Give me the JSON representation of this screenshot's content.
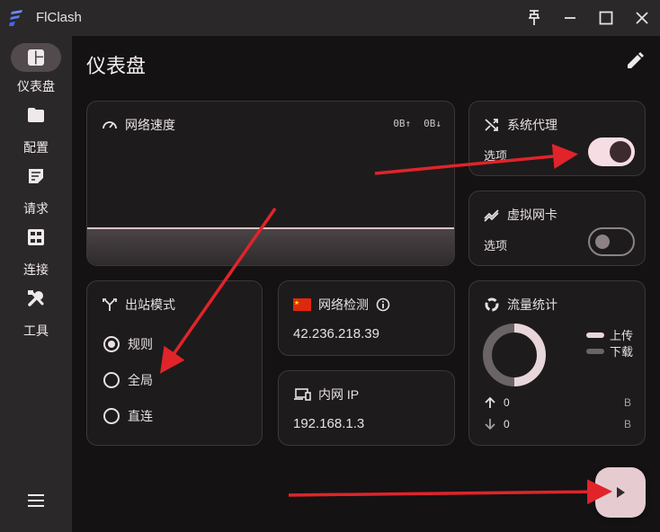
{
  "app": {
    "title": "FlClash"
  },
  "sidebar": {
    "items": [
      {
        "label": "仪表盘",
        "icon": "dashboard-icon",
        "active": true
      },
      {
        "label": "配置",
        "icon": "folder-icon",
        "active": false
      },
      {
        "label": "请求",
        "icon": "request-icon",
        "active": false
      },
      {
        "label": "连接",
        "icon": "connections-icon",
        "active": false
      },
      {
        "label": "工具",
        "icon": "tools-icon",
        "active": false
      }
    ]
  },
  "header": {
    "title": "仪表盘"
  },
  "network_speed": {
    "title": "网络速度",
    "upload": "0B↑",
    "download": "0B↓"
  },
  "system_proxy": {
    "title": "系统代理",
    "option_label": "选项",
    "enabled": true
  },
  "tun": {
    "title": "虚拟网卡",
    "option_label": "选项",
    "enabled": false
  },
  "outbound_mode": {
    "title": "出站模式",
    "options": [
      {
        "label": "规则",
        "selected": true
      },
      {
        "label": "全局",
        "selected": false
      },
      {
        "label": "直连",
        "selected": false
      }
    ]
  },
  "network_check": {
    "title": "网络检测",
    "ip": "42.236.218.39"
  },
  "intranet_ip": {
    "title": "内网 IP",
    "ip": "192.168.1.3"
  },
  "traffic": {
    "title": "流量统计",
    "legend_upload": "上传",
    "legend_download": "下载",
    "upload_value": "0",
    "upload_unit": "B",
    "download_value": "0",
    "download_unit": "B"
  },
  "colors": {
    "accent": "#f6dde3",
    "annotation_arrow": "#e0242a",
    "background": "#141213"
  }
}
